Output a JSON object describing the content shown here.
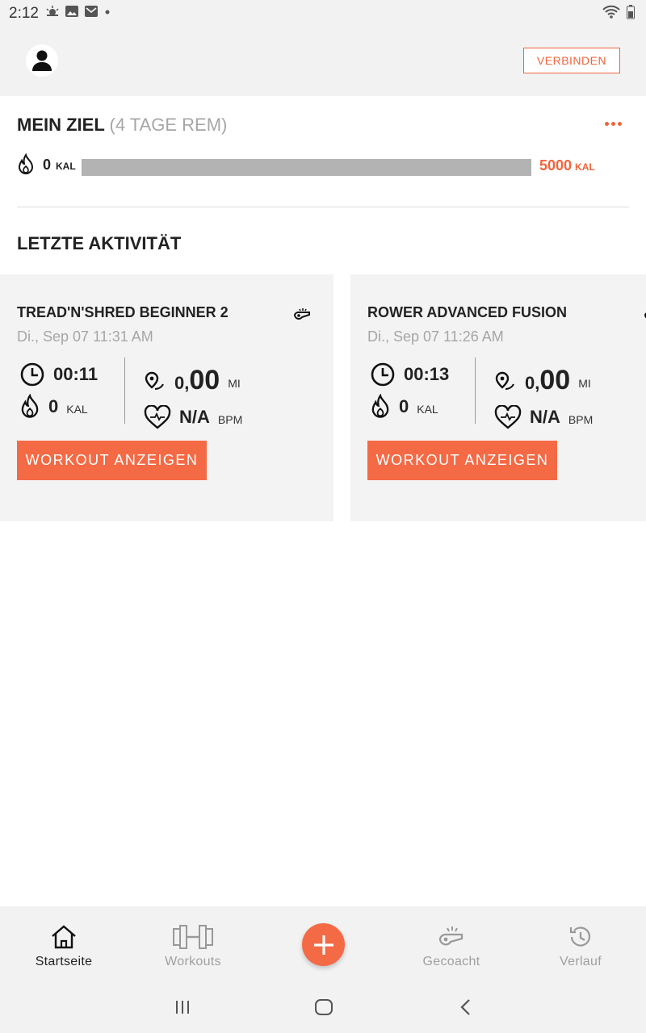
{
  "status_bar": {
    "time": "2:12"
  },
  "header": {
    "connect_label": "VERBINDEN"
  },
  "goal": {
    "title": "MEIN ZIEL",
    "remaining": "(4 TAGE REM)",
    "current_value": "0",
    "current_unit": "KAL",
    "target_value": "5000",
    "target_unit": "KAL",
    "progress_fraction": 0
  },
  "recent": {
    "title": "LETZTE AKTIVITÄT",
    "activities": [
      {
        "title": "TREAD'N'SHRED BEGINNER 2",
        "date": "Di., Sep 07 11:31 AM",
        "duration": "00:11",
        "calories": "0",
        "calories_unit": "KAL",
        "distance_int": "0,",
        "distance_dec": "00",
        "distance_unit": "MI",
        "heart_rate": "N/A",
        "heart_rate_unit": "BPM",
        "button_label": "WORKOUT ANZEIGEN"
      },
      {
        "title": "ROWER ADVANCED FUSION",
        "date": "Di., Sep 07 11:26 AM",
        "duration": "00:13",
        "calories": "0",
        "calories_unit": "KAL",
        "distance_int": "0,",
        "distance_dec": "00",
        "distance_unit": "MI",
        "heart_rate": "N/A",
        "heart_rate_unit": "BPM",
        "button_label": "WORKOUT ANZEIGEN"
      }
    ]
  },
  "bottom_nav": {
    "items": [
      {
        "label": "Startseite",
        "icon": "home-icon",
        "active": true
      },
      {
        "label": "Workouts",
        "icon": "dumbbell-icon",
        "active": false
      },
      {
        "label": "Gecoacht",
        "icon": "whistle-icon",
        "active": false
      },
      {
        "label": "Verlauf",
        "icon": "history-icon",
        "active": false
      }
    ]
  },
  "colors": {
    "accent": "#f0643c",
    "button": "#f46a45",
    "bar_bg": "#f2f2f2",
    "card_bg": "#f3f3f3"
  }
}
